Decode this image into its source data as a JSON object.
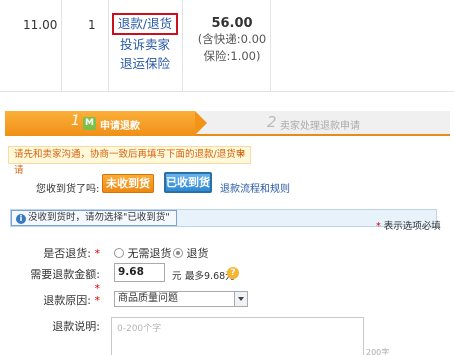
{
  "order": {
    "price": "11.00",
    "quantity": "1",
    "refund_link": "退款/退货",
    "complain_link": "投诉卖家",
    "insurance_link": "退运保险",
    "total": "56.00",
    "shipping_note": "(含快递:0.00",
    "insurance_note": "保险:1.00)"
  },
  "steps": {
    "step1_num": "1",
    "step1_icon": "M",
    "step1_label": "申请退款",
    "step2_num": "2",
    "step2_label": "卖家处理退款申请"
  },
  "notice": {
    "text": "请先和卖家沟通，协商一致后再填写下面的退款/退货申请",
    "close": "×"
  },
  "received": {
    "question": "您收到货了吗:",
    "not_received": "未收到货",
    "received": "已收到货",
    "flow_link": "退款流程和规则"
  },
  "info": {
    "icon": "i",
    "text": "没收到货时，请勿选择\"已收到货\""
  },
  "required_note": "表示选项必填",
  "form": {
    "return_label": "是否退货:",
    "no_return": "无需退货",
    "do_return": "退货",
    "amount_label": "需要退款金额:",
    "amount_value": "9.68",
    "unit": "元",
    "max": "最多9.68元",
    "help_icon": "?",
    "reason_label": "退款原因:",
    "reason_value": "商品质量问题",
    "desc_label": "退款说明:",
    "desc_placeholder": "0-200个字",
    "char_count": "200字"
  },
  "colors": {
    "orange": "#f08f16",
    "blue": "#2e8ad4",
    "link": "#2a5aa8",
    "highlight_border": "#c9101c"
  }
}
